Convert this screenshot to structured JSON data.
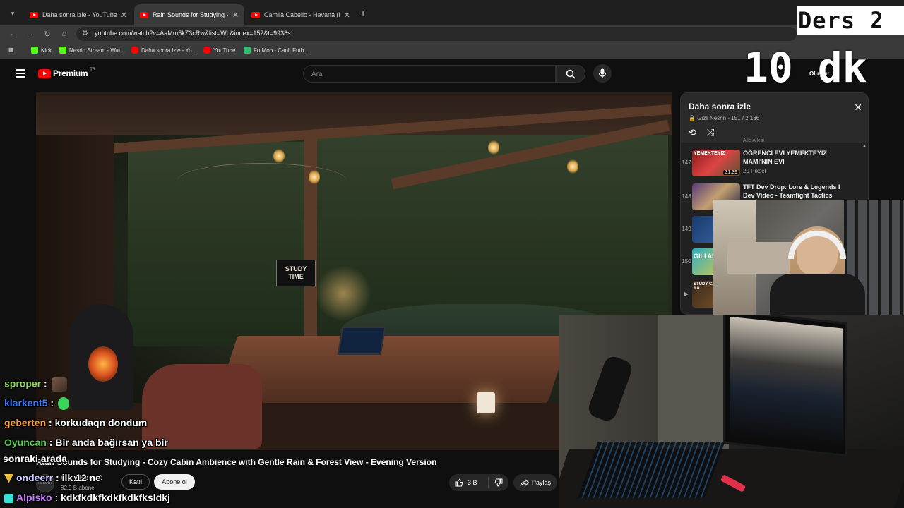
{
  "browser": {
    "tabs": [
      {
        "title": "Daha sonra izle - YouTube",
        "active": false
      },
      {
        "title": "Rain Sounds for Studying - Cozy",
        "active": true
      },
      {
        "title": "Camila Cabello - Havana (Lyrics",
        "active": false
      }
    ],
    "url": "youtube.com/watch?v=AaMm5kZ3cRw&list=WL&index=152&t=9938s",
    "bookmarks": [
      "Kick",
      "Nesrin Stream - Wat...",
      "Daha sonra izle - Yo...",
      "YouTube",
      "FotMob - Canlı Futb..."
    ]
  },
  "youtube": {
    "logo_text": "Premium",
    "region": "TR",
    "search_placeholder": "Ara",
    "create_label": "Oluştur",
    "video_sign": [
      "STUDY",
      "TIME"
    ],
    "video_title": "Rain Sounds for Studying - Cozy Cabin Ambience with Gentle Rain & Forest View - Evening Version",
    "channel": {
      "name": "Cozy Resort",
      "subscribers": "82.9 B abone",
      "avatar_text": "RESORT"
    },
    "join_label": "Katıl",
    "subscribe_label": "Abone ol",
    "likes": "3 B",
    "share_label": "Paylaş"
  },
  "playlist": {
    "title": "Daha sonra izle",
    "subtitle": "Gizli Nesrin - 151 / 2.136",
    "prev_channel": "Aile Ailesi",
    "items": [
      {
        "index": "147",
        "title": "ÖĞRENCI EVI YEMEKTEYIZ MAMI'NIN EVI",
        "channel": "20 Piksel",
        "duration": "31:39",
        "thumb_text": "YEMEKTEYIZ"
      },
      {
        "index": "148",
        "title": "TFT Dev Drop: Lore & Legends I Dev Video - Teamfight Tactics",
        "channel": "",
        "duration": "",
        "thumb_text": ""
      },
      {
        "index": "149",
        "title": "",
        "channel": "",
        "duration": "",
        "thumb_text": ""
      },
      {
        "index": "150",
        "title": "",
        "channel": "",
        "duration": "",
        "thumb_text": "GILI ADAS"
      },
      {
        "index": "",
        "title": "",
        "channel": "",
        "duration": "",
        "thumb_text": "STUDY CA EVENING RA"
      }
    ]
  },
  "overlay": {
    "header_text": "Ders 2",
    "timer_text": "10 dk"
  },
  "chat": [
    {
      "user": "sproper",
      "color": "#8bd45a",
      "text": "",
      "emote": true
    },
    {
      "user": "klarkent5",
      "color": "#3a7bff",
      "text": "",
      "emote": true
    },
    {
      "user": "geberten",
      "color": "#ff9933",
      "text": "korkudaqn dondum",
      "emote": false
    },
    {
      "user": "Oyuncan",
      "color": "#54d14a",
      "text": "Bir anda bağırsan ya bir",
      "emote": false
    },
    {
      "user": "",
      "color": "#ffffff",
      "text": "sonraki arada",
      "emote": false
    },
    {
      "user": "ondeerr",
      "color": "#c8c8ff",
      "text": "ilk 12 ne",
      "emote": false
    },
    {
      "user": "Alpisko",
      "color": "#c77dff",
      "text": "kdkfkdkfkdkfkdkfksldkj",
      "emote": false
    }
  ],
  "colors": {
    "accent_red": "#ff0000",
    "bg": "#0f0f0f",
    "panel": "#212121"
  }
}
